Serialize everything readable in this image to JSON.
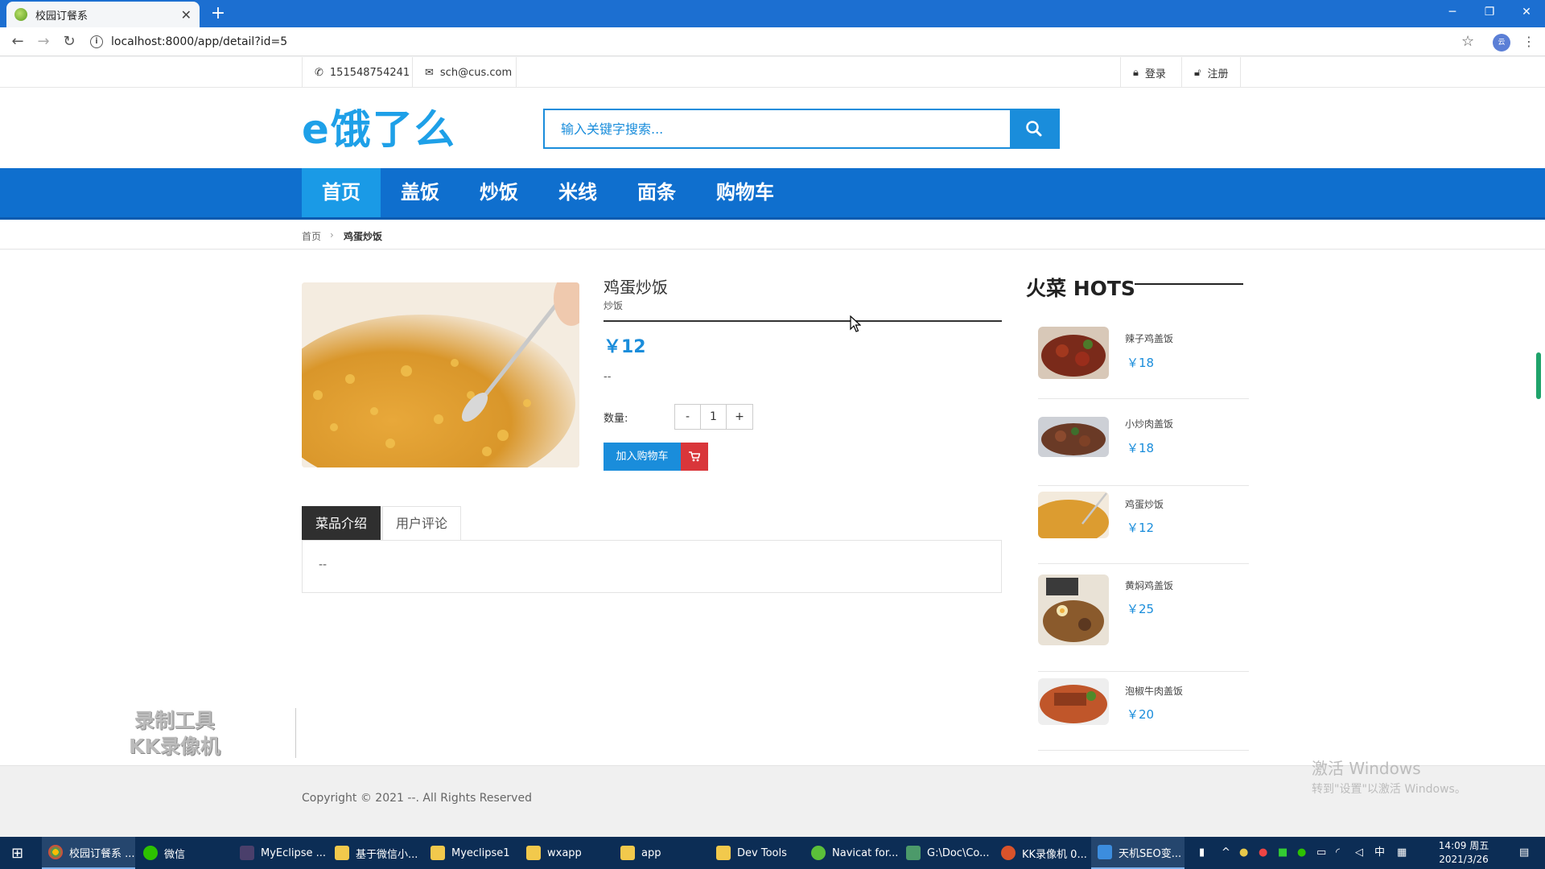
{
  "browser": {
    "tab_title": "校园订餐系",
    "url": "localhost:8000/app/detail?id=5"
  },
  "topbar": {
    "phone": "151548754241",
    "email": "sch@cus.com",
    "login": "登录",
    "register": "注册"
  },
  "header": {
    "logo": "e饿了么",
    "search_placeholder": "输入关键字搜索..."
  },
  "nav": {
    "items": [
      "首页",
      "盖饭",
      "炒饭",
      "米线",
      "面条",
      "购物车"
    ]
  },
  "breadcrumb": {
    "home": "首页",
    "current": "鸡蛋炒饭"
  },
  "product": {
    "name": "鸡蛋炒饭",
    "category": "炒饭",
    "price": "￥12",
    "description": "--",
    "quantity_label": "数量:",
    "quantity_value": "1",
    "decrease": "-",
    "increase": "+",
    "add_to_cart": "加入购物车"
  },
  "tabs": {
    "intro": "菜品介绍",
    "reviews": "用户评论",
    "intro_content": "--"
  },
  "hots": {
    "title": "火菜 HOTS",
    "items": [
      {
        "name": "辣子鸡盖饭",
        "price": "￥18"
      },
      {
        "name": "小炒肉盖饭",
        "price": "￥18"
      },
      {
        "name": "鸡蛋炒饭",
        "price": "￥12"
      },
      {
        "name": "黄焖鸡盖饭",
        "price": "￥25"
      },
      {
        "name": "泡椒牛肉盖饭",
        "price": "￥20"
      }
    ]
  },
  "footer": {
    "copyright": "Copyright © 2021 --. All Rights Reserved"
  },
  "overlay": {
    "watermark_line1": "录制工具",
    "watermark_line2": "KK录像机",
    "activate_title": "激活 Windows",
    "activate_sub": "转到\"设置\"以激活 Windows。"
  },
  "taskbar": {
    "items": [
      {
        "label": "校园订餐系 ..."
      },
      {
        "label": "微信"
      },
      {
        "label": "MyEclipse ..."
      },
      {
        "label": "基于微信小..."
      },
      {
        "label": "Myeclipse1"
      },
      {
        "label": "wxapp"
      },
      {
        "label": "app"
      },
      {
        "label": "Dev Tools"
      },
      {
        "label": "Navicat for..."
      },
      {
        "label": "G:\\Doc\\Co..."
      },
      {
        "label": "KK录像机 0..."
      },
      {
        "label": "天机SEO变..."
      }
    ],
    "ime": "中",
    "time": "14:09 周五",
    "date": "2021/3/26"
  },
  "colors": {
    "accent": "#1a8ddb",
    "nav_bg": "#0f6fce",
    "nav_active": "#1a9ae6",
    "cart_red": "#d9363a"
  }
}
